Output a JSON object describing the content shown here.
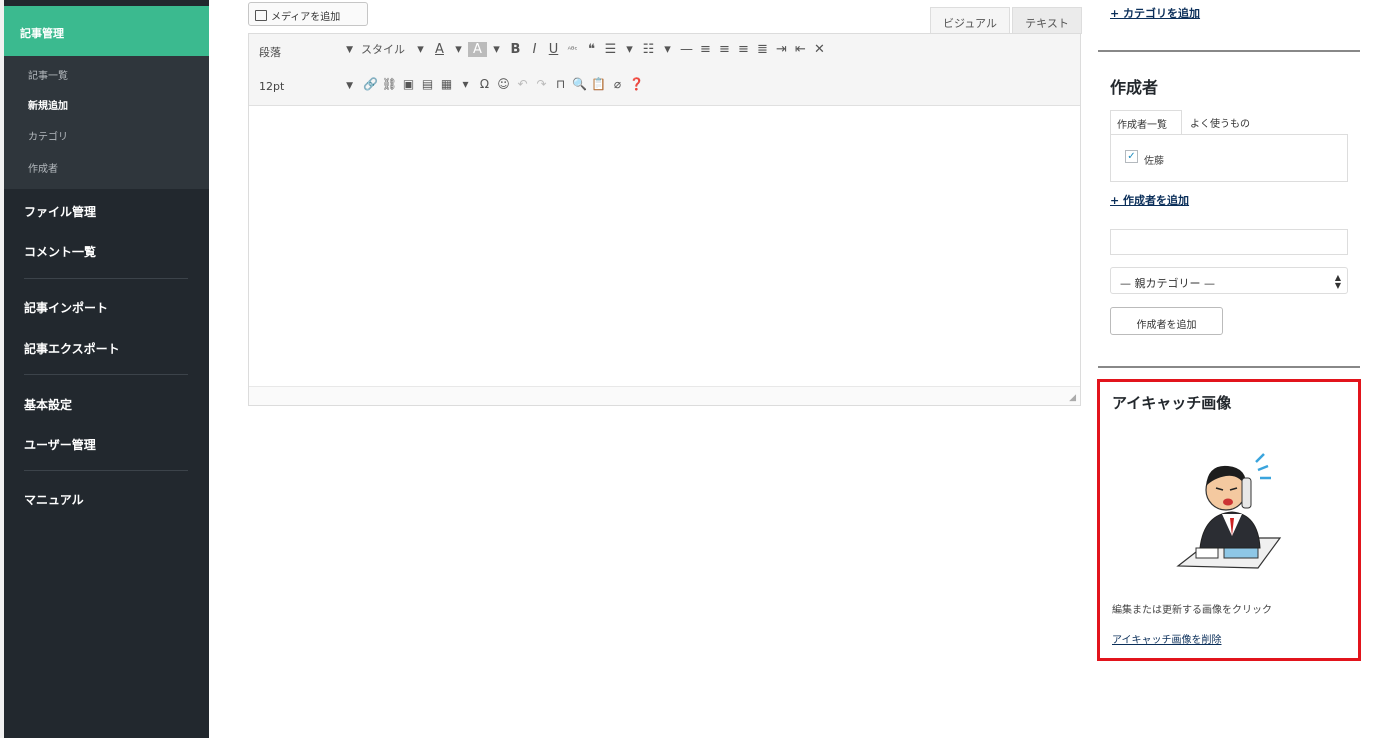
{
  "sidebar": {
    "active_section": "記事管理",
    "submenu": [
      "記事一覧",
      "新規追加",
      "カテゴリ",
      "作成者"
    ],
    "current_sub": "新規追加",
    "items": [
      "ファイル管理",
      "コメント一覧",
      "記事インポート",
      "記事エクスポート",
      "基本設定",
      "ユーザー管理",
      "マニュアル"
    ]
  },
  "editor": {
    "media_button": "メディアを追加",
    "tabs": {
      "visual": "ビジュアル",
      "text": "テキスト"
    },
    "format_select": "段落",
    "style_select": "スタイル",
    "size_select": "12pt",
    "toolbar_row1": [
      "A",
      "▾",
      "A",
      "▾",
      "B",
      "I",
      "U",
      "ᴬᴮᶜ",
      "❝",
      "☰",
      "▾",
      "☷",
      "▾",
      "—",
      "≡",
      "≡",
      "≡",
      "≣",
      "⇥",
      "⇤",
      "✕"
    ],
    "toolbar_row2": [
      "🔗",
      "⛓",
      "▣",
      "▤",
      "▦",
      "▾",
      "Ω",
      "☺",
      "↶",
      "↷",
      "⊓",
      "🔍",
      "📋",
      "⌀",
      "❓"
    ]
  },
  "right": {
    "add_category_link": "+ カテゴリを追加",
    "author_heading": "作成者",
    "author_tab_all": "作成者一覧",
    "author_tab_common": "よく使うもの",
    "author_checked": "佐藤",
    "add_author_link": "+ 作成者を追加",
    "parent_select": "— 親カテゴリー —",
    "add_author_button": "作成者を追加",
    "featured_heading": "アイキャッチ画像",
    "featured_caption": "編集または更新する画像をクリック",
    "featured_remove": "アイキャッチ画像を削除"
  },
  "colors": {
    "sidebar_bg": "#22282e",
    "active_bg": "#3bba8f",
    "highlight_border": "#e2141c"
  }
}
